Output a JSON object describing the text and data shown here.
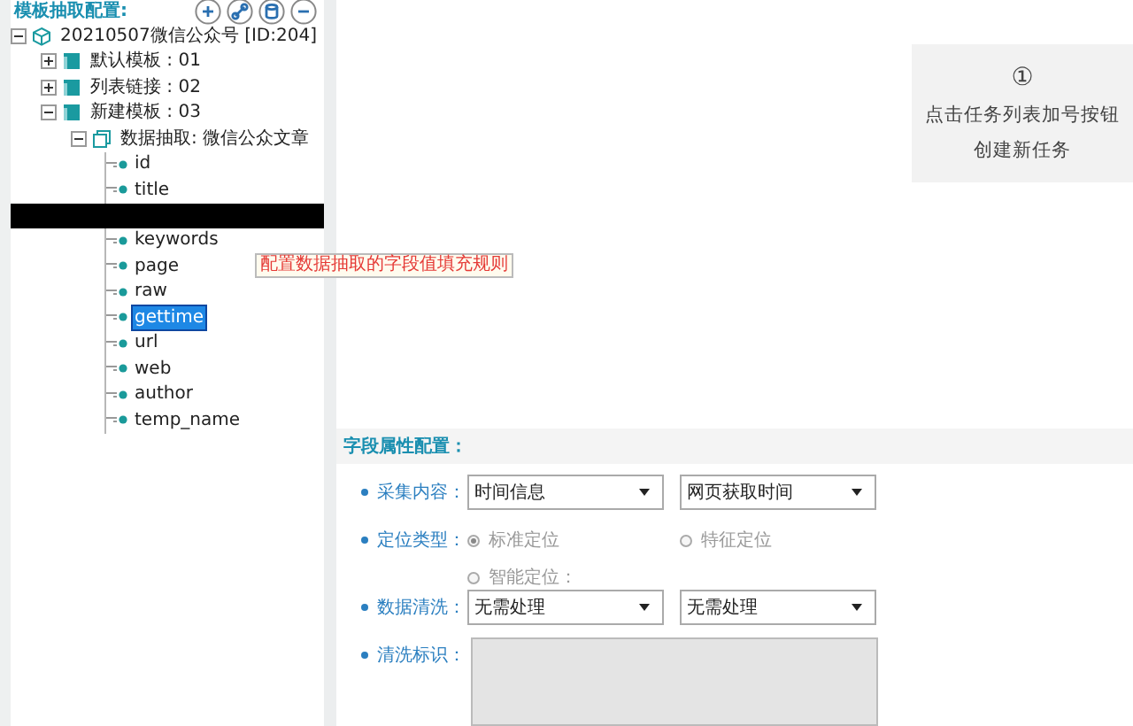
{
  "panel_title": "模板抽取配置:",
  "tree": [
    {
      "label": "20210507微信公众号 [ID:204]",
      "kind": "root",
      "expanded": true,
      "children": [
        {
          "label": "默认模板 : 01",
          "kind": "template",
          "expanded": false
        },
        {
          "label": "列表链接 : 02",
          "kind": "template",
          "expanded": false
        },
        {
          "label": "新建模板 : 03",
          "kind": "template",
          "expanded": true,
          "children": [
            {
              "label": "数据抽取: 微信公众文章",
              "kind": "extract",
              "expanded": true,
              "children": [
                {
                  "label": "id",
                  "kind": "field",
                  "selected": false
                },
                {
                  "label": "title",
                  "kind": "field",
                  "selected": false
                },
                {
                  "kind": "redacted"
                },
                {
                  "label": "keywords",
                  "kind": "field",
                  "selected": false
                },
                {
                  "label": "page",
                  "kind": "field",
                  "selected": false,
                  "tooltip": "配置数据抽取的字段值填充规则"
                },
                {
                  "label": "raw",
                  "kind": "field",
                  "selected": false
                },
                {
                  "label": "gettime",
                  "kind": "field",
                  "selected": true
                },
                {
                  "label": "url",
                  "kind": "field",
                  "selected": false
                },
                {
                  "label": "web",
                  "kind": "field",
                  "selected": false
                },
                {
                  "label": "author",
                  "kind": "field",
                  "selected": false
                },
                {
                  "label": "temp_name",
                  "kind": "field",
                  "selected": false
                }
              ]
            }
          ]
        }
      ]
    }
  ],
  "hint": {
    "step": "①",
    "lines": [
      "点击任务列表加号按钮",
      "创建新任务"
    ]
  },
  "form": {
    "title": "字段属性配置：",
    "rows": [
      {
        "label": "采集内容：",
        "kind": "selects",
        "selects": [
          "时间信息",
          "网页获取时间"
        ]
      },
      {
        "label": "定位类型：",
        "kind": "radios",
        "disabled": true,
        "options": [
          {
            "label": "标准定位",
            "selected": true
          },
          {
            "label": "特征定位",
            "selected": false
          },
          {
            "label": "智能定位：",
            "selected": false
          }
        ]
      },
      {
        "label": "数据清洗：",
        "kind": "selects",
        "selects": [
          "无需处理",
          "无需处理"
        ]
      },
      {
        "label": "清洗标识：",
        "kind": "textarea",
        "disabled": true
      }
    ]
  }
}
